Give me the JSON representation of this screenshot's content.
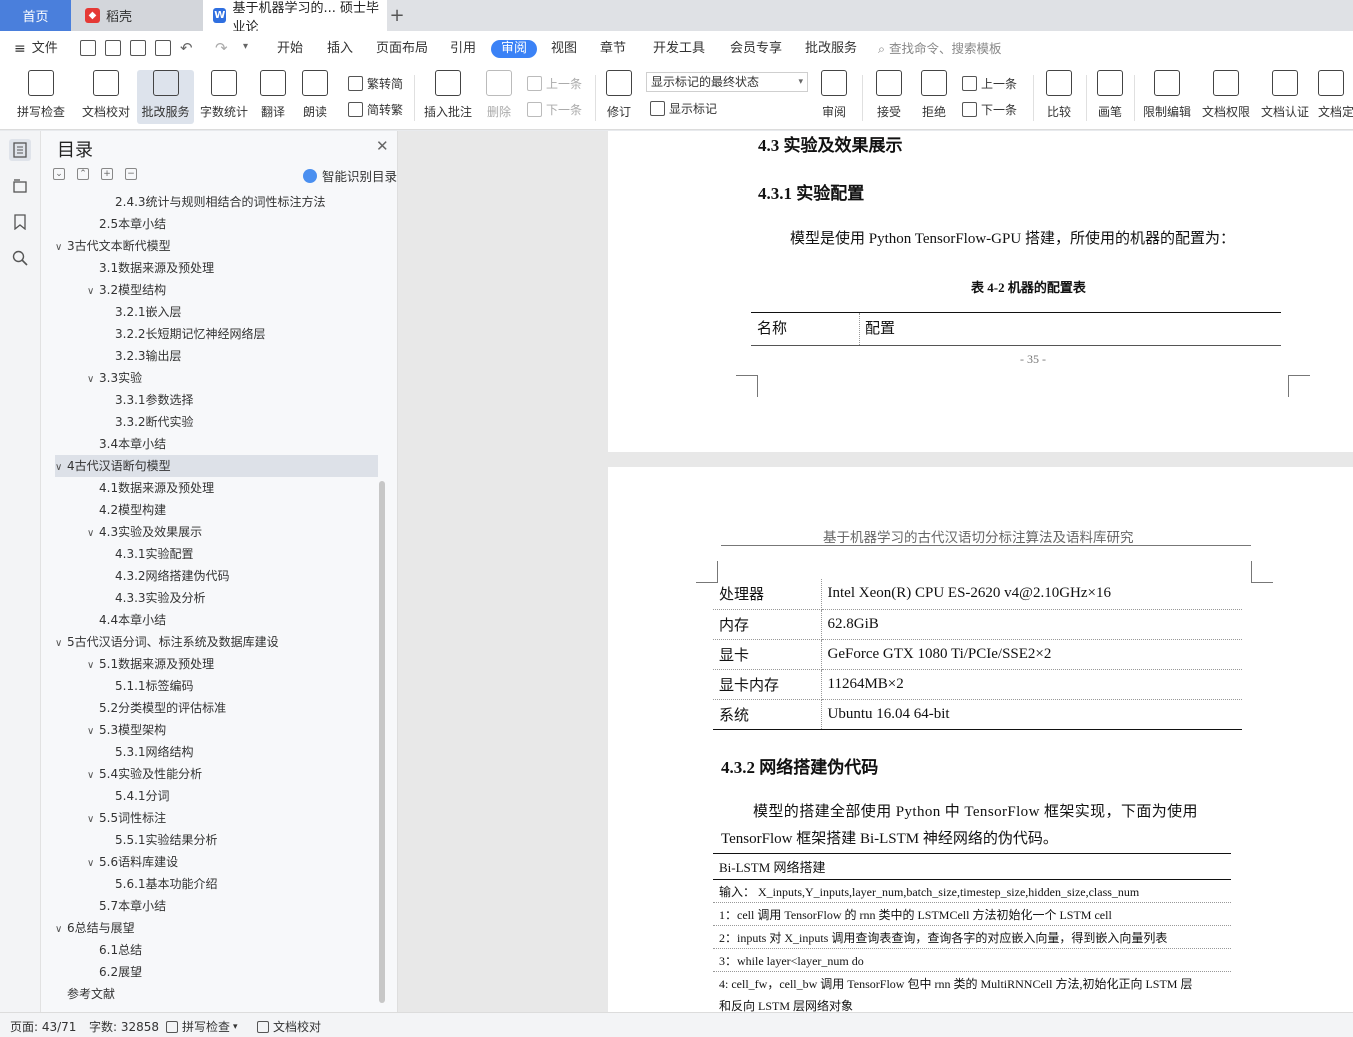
{
  "tabs": {
    "home": "首页",
    "shell": "稻壳",
    "doc": "基于机器学习的... 硕士毕业论",
    "add": "+"
  },
  "menu": {
    "file": "文件",
    "items": [
      "开始",
      "插入",
      "页面布局",
      "引用",
      "审阅",
      "视图",
      "章节",
      "开发工具",
      "会员专享",
      "批改服务"
    ],
    "search_placeholder": "查找命令、搜索模板"
  },
  "ribbon": {
    "spell_check": "拼写检查",
    "doc_proof": "文档校对",
    "correct_service": "批改服务",
    "word_count": "字数统计",
    "translate": "翻译",
    "read_aloud": "朗读",
    "trad_simp": "繁转简",
    "simp_trad": "简转繁",
    "insert_comment": "插入批注",
    "delete": "删除",
    "prev_comment": "上一条",
    "next_comment": "下一条",
    "track": "修订",
    "markup_state": "显示标记的最终状态",
    "show_markup": "显示标记",
    "review": "审阅",
    "accept": "接受",
    "reject": "拒绝",
    "prev": "上一条",
    "next": "下一条",
    "compare": "比较",
    "pen": "画笔",
    "restrict_edit": "限制编辑",
    "doc_permission": "文档权限",
    "doc_certify": "文档认证",
    "doc_more": "文档定"
  },
  "toc": {
    "title": "目录",
    "smart": "智能识别目录",
    "tools": [
      "⌄",
      "⌃",
      "+",
      "−"
    ],
    "items": [
      {
        "level": 3,
        "text": "2.4.3统计与规则相结合的词性标注方法",
        "arrow": ""
      },
      {
        "level": 2,
        "text": "2.5本章小结",
        "arrow": ""
      },
      {
        "level": 1,
        "text": "3古代文本断代模型",
        "arrow": "v"
      },
      {
        "level": 2,
        "text": "3.1数据来源及预处理",
        "arrow": ""
      },
      {
        "level": 2,
        "text": "3.2模型结构",
        "arrow": "v"
      },
      {
        "level": 3,
        "text": "3.2.1嵌入层",
        "arrow": ""
      },
      {
        "level": 3,
        "text": "3.2.2长短期记忆神经网络层",
        "arrow": ""
      },
      {
        "level": 3,
        "text": "3.2.3输出层",
        "arrow": ""
      },
      {
        "level": 2,
        "text": "3.3实验",
        "arrow": "v"
      },
      {
        "level": 3,
        "text": "3.3.1参数选择",
        "arrow": ""
      },
      {
        "level": 3,
        "text": "3.3.2断代实验",
        "arrow": ""
      },
      {
        "level": 2,
        "text": "3.4本章小结",
        "arrow": ""
      },
      {
        "level": 1,
        "text": "4古代汉语断句模型",
        "arrow": "v",
        "selected": true
      },
      {
        "level": 2,
        "text": "4.1数据来源及预处理",
        "arrow": ""
      },
      {
        "level": 2,
        "text": "4.2模型构建",
        "arrow": ""
      },
      {
        "level": 2,
        "text": "4.3实验及效果展示",
        "arrow": "v"
      },
      {
        "level": 3,
        "text": "4.3.1实验配置",
        "arrow": ""
      },
      {
        "level": 3,
        "text": "4.3.2网络搭建伪代码",
        "arrow": ""
      },
      {
        "level": 3,
        "text": "4.3.3实验及分析",
        "arrow": ""
      },
      {
        "level": 2,
        "text": "4.4本章小结",
        "arrow": ""
      },
      {
        "level": 1,
        "text": "5古代汉语分词、标注系统及数据库建设",
        "arrow": "v"
      },
      {
        "level": 2,
        "text": "5.1数据来源及预处理",
        "arrow": "v"
      },
      {
        "level": 3,
        "text": "5.1.1标签编码",
        "arrow": ""
      },
      {
        "level": 2,
        "text": "5.2分类模型的评估标准",
        "arrow": ""
      },
      {
        "level": 2,
        "text": "5.3模型架构",
        "arrow": "v"
      },
      {
        "level": 3,
        "text": "5.3.1网络结构",
        "arrow": ""
      },
      {
        "level": 2,
        "text": "5.4实验及性能分析",
        "arrow": "v"
      },
      {
        "level": 3,
        "text": "5.4.1分词",
        "arrow": ""
      },
      {
        "level": 2,
        "text": "5.5词性标注",
        "arrow": "v"
      },
      {
        "level": 3,
        "text": "5.5.1实验结果分析",
        "arrow": ""
      },
      {
        "level": 2,
        "text": "5.6语料库建设",
        "arrow": "v"
      },
      {
        "level": 3,
        "text": "5.6.1基本功能介绍",
        "arrow": ""
      },
      {
        "level": 2,
        "text": "5.7本章小结",
        "arrow": ""
      },
      {
        "level": 1,
        "text": "6总结与展望",
        "arrow": "v"
      },
      {
        "level": 2,
        "text": "6.1总结",
        "arrow": ""
      },
      {
        "level": 2,
        "text": "6.2展望",
        "arrow": ""
      },
      {
        "level": 1,
        "text": "参考文献",
        "arrow": ""
      }
    ]
  },
  "page1": {
    "h_43": "4.3  实验及效果展示",
    "h_431": "4.3.1  实验配置",
    "para": "模型是使用 Python TensorFlow-GPU 搭建，所使用的机器的配置为：",
    "table_caption": "表 4-2  机器的配置表",
    "table_head": [
      "名称",
      "配置"
    ],
    "page_num": "- 35 -"
  },
  "page2": {
    "header": "基于机器学习的古代汉语切分标注算法及语料库研究",
    "config_rows": [
      [
        "处理器",
        "Intel Xeon(R) CPU ES-2620 v4@2.10GHz×16"
      ],
      [
        "内存",
        "62.8GiB"
      ],
      [
        "显卡",
        "GeForce GTX 1080 Ti/PCIe/SSE2×2"
      ],
      [
        "显卡内存",
        "11264MB×2"
      ],
      [
        "系统",
        "Ubuntu 16.04 64-bit"
      ]
    ],
    "h_432": "4.3.2  网络搭建伪代码",
    "para_line1": "模型的搭建全部使用 Python 中 TensorFlow 框架实现，下面为使用",
    "para_line2": "TensorFlow 框架搭建 Bi-LSTM 神经网络的伪代码。",
    "pseudo_title": "Bi-LSTM 网络搭建",
    "pseudo_rows": [
      "输入：  X_inputs,Y_inputs,layer_num,batch_size,timestep_size,hidden_size,class_num",
      "1：cell 调用 TensorFlow 的 rnn 类中的 LSTMCell 方法初始化一个 LSTM cell",
      "2：inputs 对 X_inputs 调用查询表查询，查询各字的对应嵌入向量，得到嵌入向量列表",
      "3：while layer<layer_num do",
      "4:        cell_fw，cell_bw 调用 TensorFlow 包中 rnn 类的 MultiRNNCell 方法,初始化正向 LSTM 层",
      "和反向 LSTM 层网络对象"
    ]
  },
  "status": {
    "page": "页面: 43/71",
    "words": "字数: 32858",
    "spell": "拼写检查",
    "proof": "文档校对"
  },
  "colors": {
    "accent": "#3b82f6",
    "home_tab": "#4a7fdc",
    "shell_icon": "#e53935",
    "doc_icon": "#2f6fe0"
  }
}
